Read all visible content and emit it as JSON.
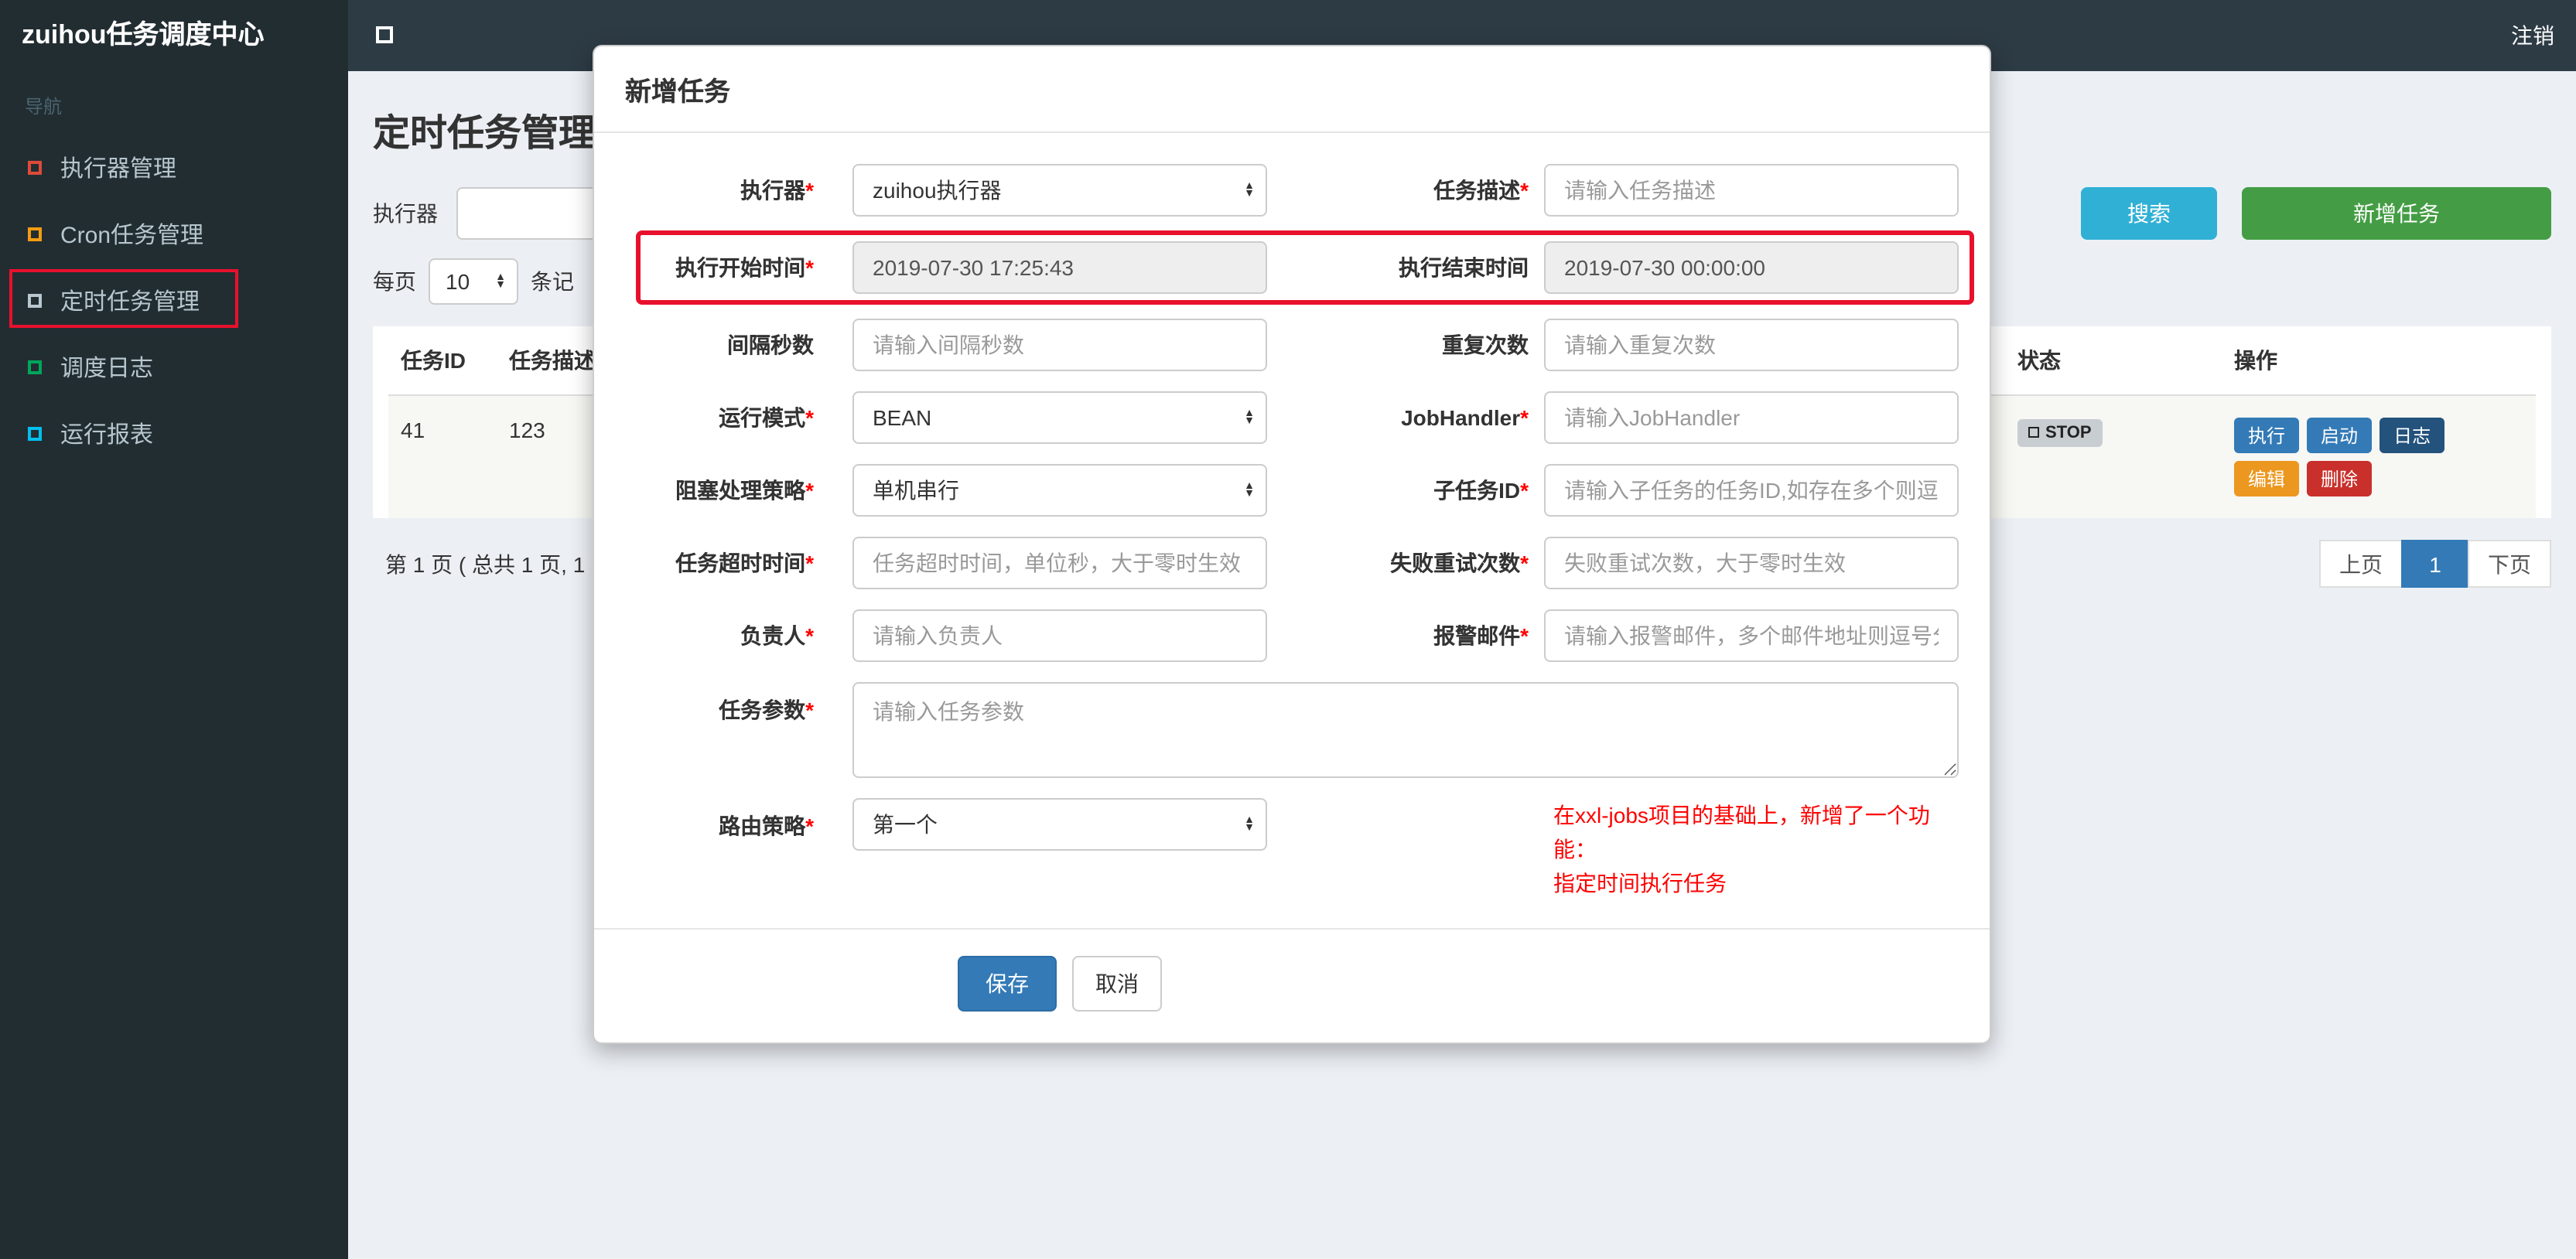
{
  "navbar": {
    "brand": "zuihou任务调度中心",
    "logout": "注销"
  },
  "sidebar": {
    "header": "导航",
    "items": [
      {
        "label": "执行器管理",
        "icon_style": "border-color:#dd4b39"
      },
      {
        "label": "Cron任务管理",
        "icon_style": "border-color:#f39c12"
      },
      {
        "label": "定时任务管理",
        "icon_style": "border-color:#b8c7ce",
        "highlighted": true
      },
      {
        "label": "调度日志",
        "icon_style": "border-color:#00a65a"
      },
      {
        "label": "运行报表",
        "icon_style": "border-color:#00c0ef"
      }
    ]
  },
  "page": {
    "title": "定时任务管理",
    "toolbar": {
      "executor_label": "执行器",
      "search_button": "搜索",
      "add_button": "新增任务"
    },
    "perpage": {
      "label": "每页",
      "value": "10",
      "suffix": "条记"
    },
    "table": {
      "headers": [
        "任务ID",
        "任务描述",
        "状态",
        "操作"
      ],
      "row": {
        "id": "41",
        "desc": "123",
        "status": "STOP",
        "actions": [
          {
            "label": "执行",
            "style": "background:#337ab7"
          },
          {
            "label": "启动",
            "style": "background:#337ab7"
          },
          {
            "label": "日志",
            "style": "background:#23527c"
          },
          {
            "label": "编辑",
            "style": "background:#ec971f"
          },
          {
            "label": "删除",
            "style": "background:#c9302c"
          }
        ]
      }
    },
    "pagination": {
      "summary": "第 1 页 ( 总共 1 页, 1",
      "prev": "上页",
      "current": "1",
      "next": "下页"
    }
  },
  "modal": {
    "title": "新增任务",
    "executor": {
      "label": "执行器",
      "required": "*",
      "value": "zuihou执行器"
    },
    "job_desc": {
      "label": "任务描述",
      "required": "*",
      "placeholder": "请输入任务描述"
    },
    "start_time": {
      "label": "执行开始时间",
      "required": "*",
      "value": "2019-07-30 17:25:43"
    },
    "end_time": {
      "label": "执行结束时间",
      "value": "2019-07-30 00:00:00"
    },
    "interval": {
      "label": "间隔秒数",
      "placeholder": "请输入间隔秒数"
    },
    "repeat": {
      "label": "重复次数",
      "placeholder": "请输入重复次数"
    },
    "run_mode": {
      "label": "运行模式",
      "required": "*",
      "value": "BEAN"
    },
    "job_handler": {
      "label": "JobHandler",
      "required": "*",
      "placeholder": "请输入JobHandler"
    },
    "block_strategy": {
      "label": "阻塞处理策略",
      "required": "*",
      "value": "单机串行"
    },
    "child_job": {
      "label": "子任务ID",
      "required": "*",
      "placeholder": "请输入子任务的任务ID,如存在多个则逗"
    },
    "timeout": {
      "label": "任务超时时间",
      "required": "*",
      "placeholder": "任务超时时间，单位秒，大于零时生效"
    },
    "retry": {
      "label": "失败重试次数",
      "required": "*",
      "placeholder": "失败重试次数，大于零时生效"
    },
    "owner": {
      "label": "负责人",
      "required": "*",
      "placeholder": "请输入负责人"
    },
    "alarm_email": {
      "label": "报警邮件",
      "required": "*",
      "placeholder": "请输入报警邮件，多个邮件地址则逗号分"
    },
    "job_param": {
      "label": "任务参数",
      "required": "*",
      "placeholder": "请输入任务参数"
    },
    "route_strategy": {
      "label": "路由策略",
      "required": "*",
      "value": "第一个"
    },
    "note_line1": "在xxl-jobs项目的基础上，新增了一个功能：",
    "note_line2": "指定时间执行任务",
    "save_button": "保存",
    "cancel_button": "取消"
  },
  "colors": {
    "search_button": "#31b0d5",
    "add_button": "#449d44",
    "annotation": "#e8112d",
    "save_button": "#337ab7",
    "sidebar_bg": "#222d32",
    "navbar_bg": "#2d3b45"
  }
}
